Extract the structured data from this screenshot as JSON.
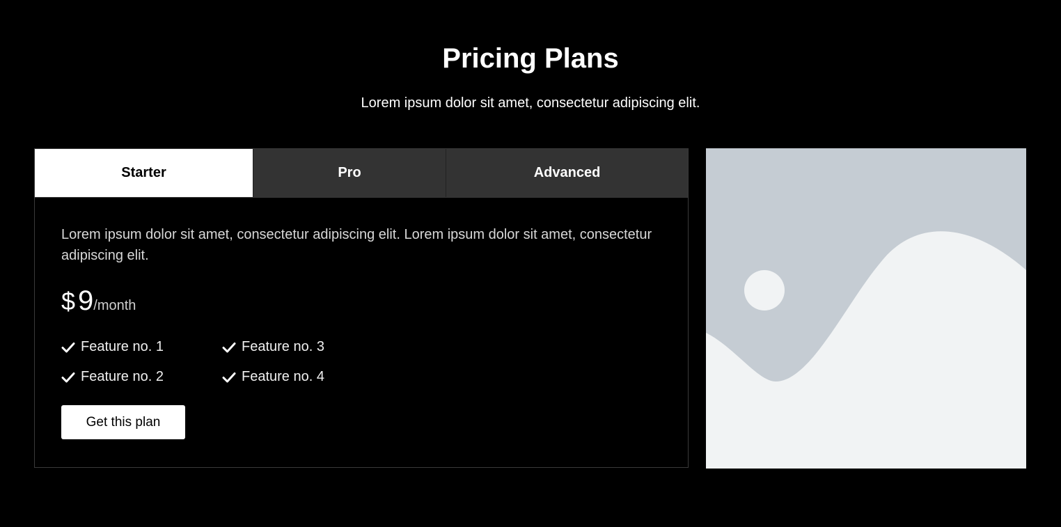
{
  "section": {
    "title": "Pricing Plans",
    "subtitle": "Lorem ipsum dolor sit amet, consectetur adipiscing elit."
  },
  "tabs": [
    {
      "label": "Starter",
      "active": true
    },
    {
      "label": "Pro",
      "active": false
    },
    {
      "label": "Advanced",
      "active": false
    }
  ],
  "plan": {
    "description": "Lorem ipsum dolor sit amet, consectetur adipiscing elit. Lorem ipsum dolor sit amet, consectetur adipiscing elit.",
    "currency": "$",
    "amount": "9",
    "period": "/month",
    "features": [
      "Feature no. 1",
      "Feature no. 3",
      "Feature no. 2",
      "Feature no. 4"
    ],
    "cta_label": "Get this plan"
  },
  "image": {
    "icon": "landscape-placeholder-icon",
    "colors": {
      "sky": "#c5ccd3",
      "hills": "#f1f3f4",
      "sun": "#f1f3f4"
    }
  },
  "colors": {
    "background": "#000000",
    "tab_active_bg": "#ffffff",
    "tab_inactive_bg": "#333333",
    "button_bg": "#ffffff"
  }
}
